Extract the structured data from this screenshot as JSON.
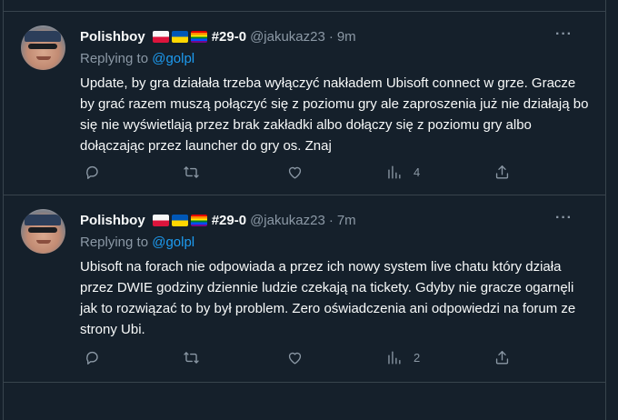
{
  "tweets": [
    {
      "name": "Polishboy",
      "tag": "#29-0",
      "handle": "@jakukaz23",
      "separator": "·",
      "time": "9m",
      "replying_prefix": "Replying to",
      "replying_handle": "@golpl",
      "text": "Update, by gra działała trzeba wyłączyć nakładem Ubisoft connect w grze. Gracze by grać razem muszą połączyć się z poziomu gry ale zaproszenia już nie działają bo się nie wyświetlają przez brak zakładki albo dołączy się z poziomu gry albo dołączając przez launcher do gry os. Znaj",
      "views": "4"
    },
    {
      "name": "Polishboy",
      "tag": "#29-0",
      "handle": "@jakukaz23",
      "separator": "·",
      "time": "7m",
      "replying_prefix": "Replying to",
      "replying_handle": "@golpl",
      "text": "Ubisoft na forach nie odpowiada a przez ich nowy system live chatu który działa przez DWIE godziny dziennie ludzie czekają na tickety. Gdyby nie gracze ogarnęli jak to rozwiązać to by był problem. Zero oświadczenia ani odpowiedzi na forum ze strony Ubi.",
      "views": "2"
    }
  ],
  "more_label": "···",
  "icons": [
    "reply-icon",
    "retweet-icon",
    "like-icon",
    "views-icon",
    "share-icon"
  ],
  "colors": {
    "background": "#15202b",
    "text": "#f7f9f9",
    "muted": "#8b98a5",
    "accent": "#1d9bf0",
    "border": "#38444d"
  }
}
